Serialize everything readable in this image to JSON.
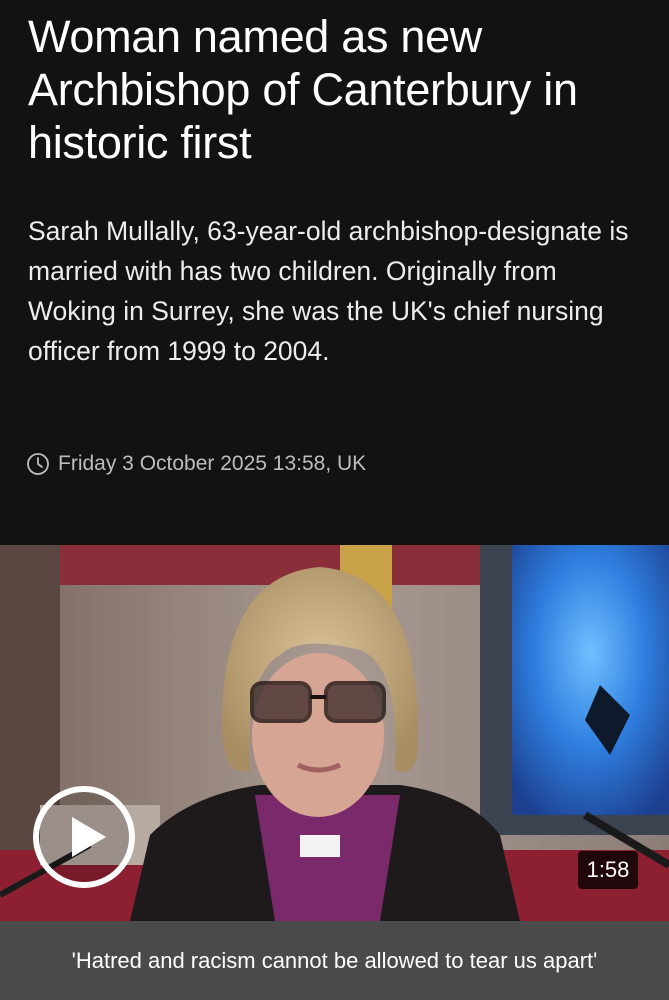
{
  "article": {
    "headline": "Woman named as new Archbishop of Canterbury in historic first",
    "standfirst": "Sarah Mullally, 63-year-old archbishop-designate is married with has two children. Originally from Woking in Surrey, she was the UK's chief nursing officer from 1999 to 2004.",
    "timestamp": "Friday 3 October 2025 13:58, UK",
    "timestamp_icon": "clock-icon"
  },
  "video": {
    "play_icon": "play-icon",
    "duration": "1:58",
    "caption": "'Hatred and racism cannot be allowed to tear us apart'"
  },
  "colors": {
    "background": "#121212",
    "caption_bar": "#4a4a4a",
    "text": "#ffffff",
    "muted_text": "#bdbdbd"
  }
}
